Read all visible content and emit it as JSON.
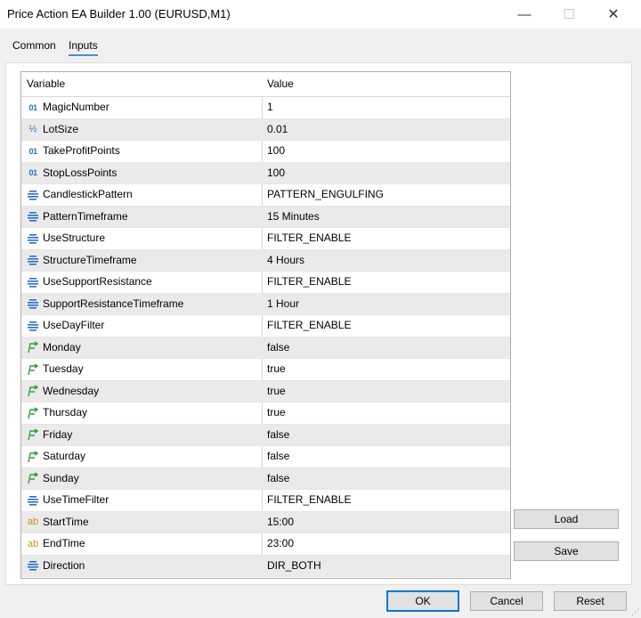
{
  "window": {
    "title": "Price Action EA Builder 1.00 (EURUSD,M1)",
    "minimize_glyph": "—",
    "maximize_glyph": "☐",
    "close_glyph": "✕"
  },
  "tabs": [
    {
      "label": "Common"
    },
    {
      "label": "Inputs"
    }
  ],
  "grid": {
    "columns": {
      "variable": "Variable",
      "value": "Value"
    },
    "rows": [
      {
        "type": "int",
        "icon": "01",
        "name": "MagicNumber",
        "value": "1"
      },
      {
        "type": "double",
        "icon": "½",
        "name": "LotSize",
        "value": "0.01"
      },
      {
        "type": "int",
        "icon": "01",
        "name": "TakeProfitPoints",
        "value": "100"
      },
      {
        "type": "int",
        "icon": "01",
        "name": "StopLossPoints",
        "value": "100"
      },
      {
        "type": "enum",
        "name": "CandlestickPattern",
        "value": "PATTERN_ENGULFING"
      },
      {
        "type": "enum",
        "name": "PatternTimeframe",
        "value": "15 Minutes"
      },
      {
        "type": "enum",
        "name": "UseStructure",
        "value": "FILTER_ENABLE"
      },
      {
        "type": "enum",
        "name": "StructureTimeframe",
        "value": "4 Hours"
      },
      {
        "type": "enum",
        "name": "UseSupportResistance",
        "value": "FILTER_ENABLE"
      },
      {
        "type": "enum",
        "name": "SupportResistanceTimeframe",
        "value": "1 Hour"
      },
      {
        "type": "enum",
        "name": "UseDayFilter",
        "value": "FILTER_ENABLE"
      },
      {
        "type": "bool",
        "name": "Monday",
        "value": "false"
      },
      {
        "type": "bool",
        "name": "Tuesday",
        "value": "true"
      },
      {
        "type": "bool",
        "name": "Wednesday",
        "value": "true"
      },
      {
        "type": "bool",
        "name": "Thursday",
        "value": "true"
      },
      {
        "type": "bool",
        "name": "Friday",
        "value": "false"
      },
      {
        "type": "bool",
        "name": "Saturday",
        "value": "false"
      },
      {
        "type": "bool",
        "name": "Sunday",
        "value": "false"
      },
      {
        "type": "enum",
        "name": "UseTimeFilter",
        "value": "FILTER_ENABLE"
      },
      {
        "type": "string",
        "icon": "ab",
        "name": "StartTime",
        "value": "15:00"
      },
      {
        "type": "string",
        "icon": "ab",
        "name": "EndTime",
        "value": "23:00"
      },
      {
        "type": "enum",
        "name": "Direction",
        "value": "DIR_BOTH"
      }
    ]
  },
  "buttons": {
    "load": "Load",
    "save": "Save",
    "ok": "OK",
    "cancel": "Cancel",
    "reset": "Reset"
  },
  "colors": {
    "accent": "#0078d7",
    "tab_underline": "#4b8fd6",
    "int_icon": "#2a6fc9",
    "bool_icon": "#2e9e3a",
    "string_icon": "#c8921a"
  }
}
